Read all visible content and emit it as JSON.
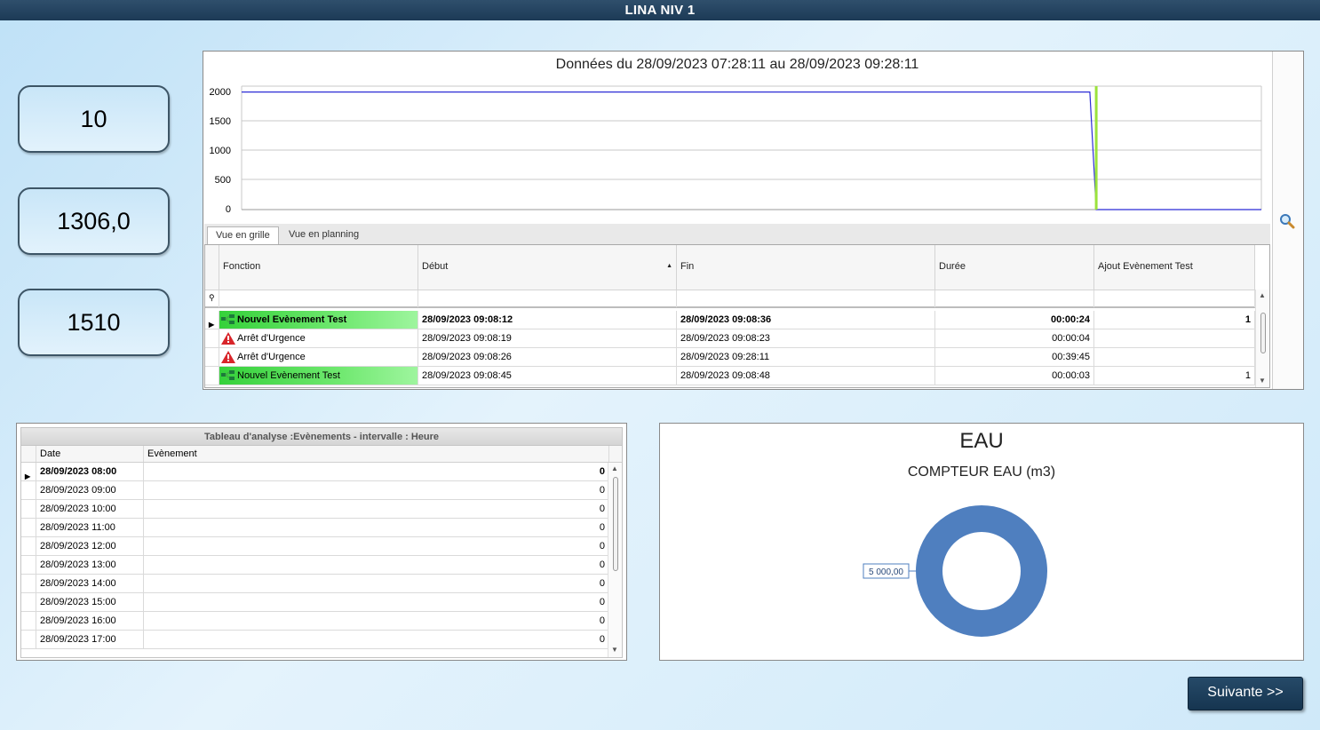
{
  "window": {
    "title": "LINA NIV 1"
  },
  "kpis": [
    {
      "value": "10"
    },
    {
      "value": "1306,0"
    },
    {
      "value": "1510"
    }
  ],
  "trend_chart": {
    "title": "Données du 28/09/2023 07:28:11 au 28/09/2023 09:28:11",
    "y_ticks": [
      "2000",
      "1500",
      "1000",
      "500",
      "0"
    ],
    "colors": {
      "series": "#2b2bd6",
      "marker": "#9be33c",
      "grid": "#c8c8c8"
    }
  },
  "chart_data": {
    "type": "line",
    "title": "Données du 28/09/2023 07:28:11 au 28/09/2023 09:28:11",
    "xlabel": "",
    "ylabel": "",
    "ylim": [
      0,
      2100
    ],
    "x_range": [
      "28/09/2023 07:28:11",
      "28/09/2023 09:28:11"
    ],
    "series": [
      {
        "x": [
          "07:28:11",
          "09:08:00",
          "09:08:45",
          "09:28:11"
        ],
        "values": [
          2000,
          2000,
          0,
          0
        ]
      }
    ],
    "marker_at": "09:08:45",
    "grid": true
  },
  "tabs": [
    {
      "label": "Vue en grille",
      "active": true
    },
    {
      "label": "Vue en planning",
      "active": false
    }
  ],
  "events_grid": {
    "columns": [
      "Fonction",
      "Début",
      "Fin",
      "Durée",
      "Ajout Evènement Test"
    ],
    "rows": [
      {
        "fonction": "Nouvel Evènement Test",
        "type": "test",
        "debut": "28/09/2023 09:08:12",
        "fin": "28/09/2023 09:08:36",
        "duree": "00:00:24",
        "ajout": "1",
        "selected": true
      },
      {
        "fonction": "Arrêt d'Urgence",
        "type": "alarm",
        "debut": "28/09/2023 09:08:19",
        "fin": "28/09/2023 09:08:23",
        "duree": "00:00:04",
        "ajout": ""
      },
      {
        "fonction": "Arrêt d'Urgence",
        "type": "alarm",
        "debut": "28/09/2023 09:08:26",
        "fin": "28/09/2023 09:28:11",
        "duree": "00:39:45",
        "ajout": ""
      },
      {
        "fonction": "Nouvel Evènement Test",
        "type": "test",
        "debut": "28/09/2023 09:08:45",
        "fin": "28/09/2023 09:08:48",
        "duree": "00:00:03",
        "ajout": "1"
      }
    ]
  },
  "analysis": {
    "title": "Tableau d'analyse :Evènements - intervalle : Heure",
    "columns": [
      "Date",
      "Evènement"
    ],
    "rows": [
      {
        "date": "28/09/2023 08:00",
        "value": "0"
      },
      {
        "date": "28/09/2023 09:00",
        "value": "0"
      },
      {
        "date": "28/09/2023 10:00",
        "value": "0"
      },
      {
        "date": "28/09/2023 11:00",
        "value": "0"
      },
      {
        "date": "28/09/2023 12:00",
        "value": "0"
      },
      {
        "date": "28/09/2023 13:00",
        "value": "0"
      },
      {
        "date": "28/09/2023 14:00",
        "value": "0"
      },
      {
        "date": "28/09/2023 15:00",
        "value": "0"
      },
      {
        "date": "28/09/2023 16:00",
        "value": "0"
      },
      {
        "date": "28/09/2023 17:00",
        "value": "0"
      }
    ]
  },
  "eau": {
    "title": "EAU",
    "subtitle": "COMPTEUR EAU (m3)",
    "donut_label": "5 000,00",
    "donut_value": 5000,
    "color": "#4f7fbf"
  },
  "next_button": {
    "label": "Suivante  >>"
  }
}
